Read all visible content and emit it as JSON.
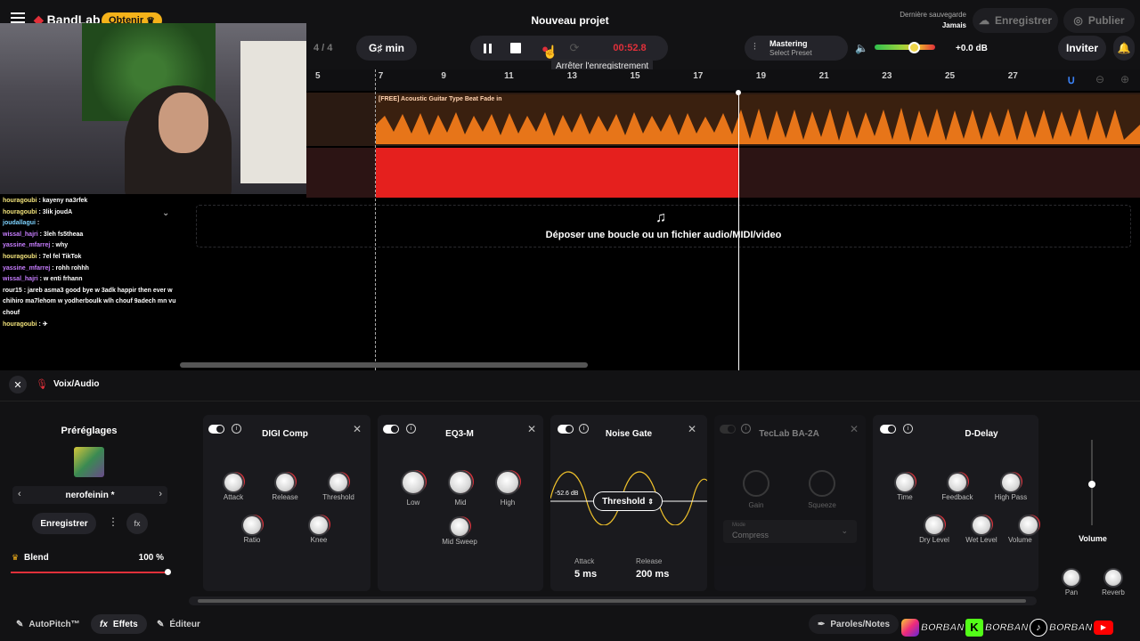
{
  "app": {
    "brand": "BandLab",
    "upgrade_label": "Obtenir",
    "project_title": "Nouveau projet"
  },
  "header": {
    "last_saved_label": "Dernière sauvegarde",
    "last_saved_value": "Jamais",
    "save_label": "Enregistrer",
    "publish_label": "Publier",
    "invite_label": "Inviter",
    "time_signature": "4 / 4",
    "key": "G♯ min",
    "time_display": "00:52.8",
    "tooltip": "Arrêter l'enregistrement",
    "mastering_label": "Mastering",
    "mastering_preset": "Select Preset",
    "volume_db": "+0.0 dB"
  },
  "ruler": [
    "5",
    "7",
    "9",
    "11",
    "13",
    "15",
    "17",
    "19",
    "21",
    "23",
    "25",
    "27"
  ],
  "tracks": {
    "clip_name": "[FREE] Acoustic Guitar Type Beat Fade in"
  },
  "drop_zone": {
    "text": "Déposer une boucle ou un fichier audio/MIDI/video"
  },
  "chat": [
    {
      "user": "houragoubi",
      "msg": "kayeny na3rfek",
      "cls": "cu"
    },
    {
      "user": "houragoubi",
      "msg": "3lik joudA",
      "cls": "cu"
    },
    {
      "user": "joudallagui",
      "msg": "",
      "cls": "cw"
    },
    {
      "user": "wissal_hajri",
      "msg": "3leh fs5theaa",
      "cls": "cp"
    },
    {
      "user": "yassine_mfarrej",
      "msg": "why",
      "cls": "cp"
    },
    {
      "user": "houragoubi",
      "msg": "7el fel TikTok",
      "cls": "cu"
    },
    {
      "user": "yassine_mfarrej",
      "msg": "rohh rohhh",
      "cls": "cp"
    },
    {
      "user": "wissal_hajri",
      "msg": "w enti frhann",
      "cls": "cp"
    },
    {
      "user": "rour15",
      "msg": "jareb asma3 good bye w 3adk happir then ever w chihiro ma7lehom w yodherboulk wlh chouf 9adech mn vu chouf",
      "cls": ""
    },
    {
      "user": "houragoubi",
      "msg": "✈",
      "cls": "cu"
    }
  ],
  "fx_panel": {
    "track_name": "Voix/Audio",
    "presets_title": "Préréglages",
    "preset_name": "nerofeinin *",
    "save_label": "Enregistrer",
    "blend_label": "Blend",
    "blend_value": "100 %",
    "blend_fraction": 1.0,
    "volume_label": "Volume",
    "pan_label": "Pan",
    "reverb_label": "Reverb"
  },
  "effects": [
    {
      "name": "DIGI Comp",
      "knobs": [
        "Attack",
        "Release",
        "Threshold",
        "Ratio",
        "Knee"
      ]
    },
    {
      "name": "EQ3-M",
      "knobs": [
        "Low",
        "Mid",
        "High",
        "Mid Sweep"
      ]
    },
    {
      "name": "Noise Gate",
      "threshold_label": "Threshold",
      "db": "-52.6 dB",
      "attack_label": "Attack",
      "attack_value": "5 ms",
      "release_label": "Release",
      "release_value": "200 ms"
    },
    {
      "name": "TecLab BA-2A",
      "knobs": [
        "Gain",
        "Squeeze"
      ],
      "mode_label": "Mode",
      "mode_value": "Compress"
    },
    {
      "name": "D-Delay",
      "knobs": [
        "Time",
        "Feedback",
        "High Pass",
        "Dry Level",
        "Wet Level",
        "Volume"
      ]
    }
  ],
  "bottom": {
    "autopitch": "AutoPitch™",
    "effects": "Effets",
    "editor": "Éditeur",
    "lyrics": "Paroles/Notes",
    "handle": "BORBAN"
  },
  "colors": {
    "accent_red": "#e0303a",
    "waveform_orange": "#f07a1a",
    "record_red": "#e5201e"
  }
}
